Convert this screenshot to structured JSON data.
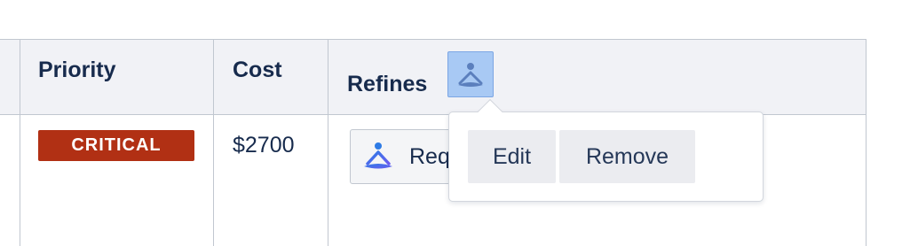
{
  "table": {
    "headers": {
      "priority": "Priority",
      "cost": "Cost",
      "refines": "Refines"
    },
    "row": {
      "priority": "CRITICAL",
      "cost": "$2700",
      "refines_chip_label": "Req"
    }
  },
  "popup": {
    "edit_label": "Edit",
    "remove_label": "Remove"
  },
  "icons": {
    "header_icon": "user-avatar-icon",
    "chip_icon": "user-avatar-icon"
  },
  "colors": {
    "priority_badge": "#b13014",
    "header_bg": "#f1f2f6",
    "icon_highlight": "#a8c9f4",
    "text": "#172b4d"
  }
}
